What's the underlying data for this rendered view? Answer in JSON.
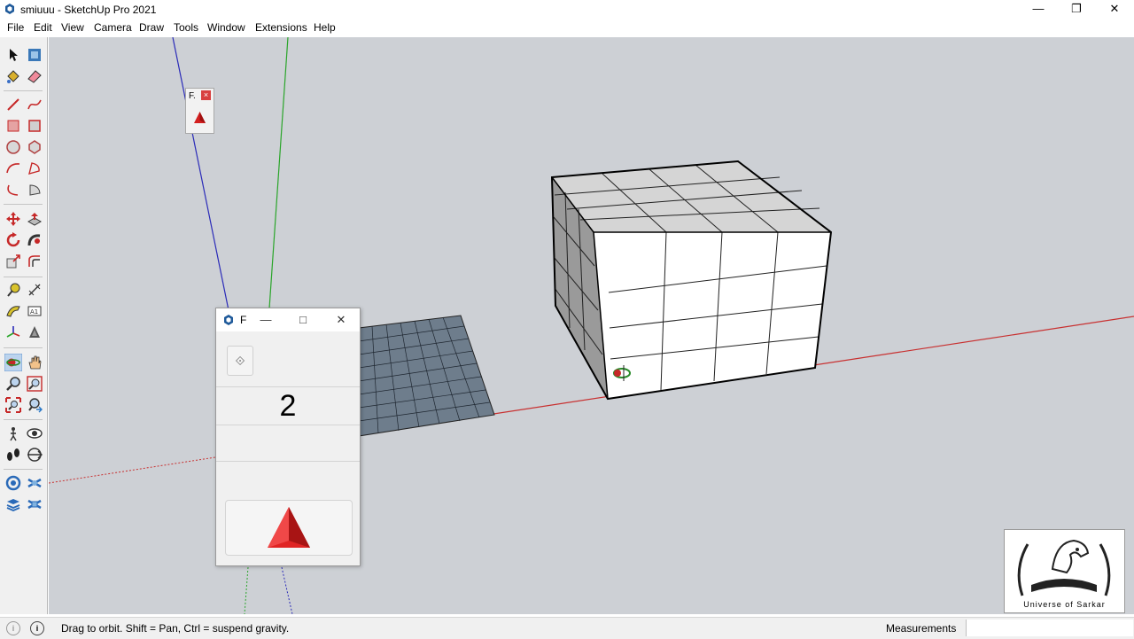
{
  "window": {
    "title": "smiuuu - SketchUp Pro 2021",
    "controls": [
      "minimize",
      "restore",
      "close"
    ]
  },
  "menu": {
    "items": [
      "File",
      "Edit",
      "View",
      "Camera",
      "Draw",
      "Tools",
      "Window",
      "Extensions",
      "Help"
    ]
  },
  "toolbar": {
    "tools": [
      "select-icon",
      "make-component-icon",
      "paint-bucket-icon",
      "eraser-icon",
      "line-icon",
      "freehand-icon",
      "rectangle-icon",
      "rotated-rectangle-icon",
      "circle-icon",
      "polygon-icon",
      "arc-icon",
      "two-point-arc-icon",
      "three-point-arc-icon",
      "pie-icon",
      "move-icon",
      "push-pull-icon",
      "rotate-icon",
      "follow-me-icon",
      "scale-icon",
      "offset-icon",
      "tape-measure-icon",
      "dimension-icon",
      "protractor-icon",
      "text-icon",
      "axes-icon",
      "3d-text-icon",
      "orbit-icon",
      "pan-icon",
      "zoom-icon",
      "zoom-window-icon",
      "zoom-extents-icon",
      "previous-view-icon",
      "position-camera-icon",
      "look-around-icon",
      "walk-icon",
      "section-plane-icon",
      "warehouse-icon",
      "extension-warehouse-icon",
      "layout-icon",
      "extension-manager-icon"
    ]
  },
  "mini_panel": {
    "title": "F.",
    "close": "×",
    "icon": "red-pyramid-icon"
  },
  "plugin_window": {
    "title": "F",
    "controls": [
      "minimize",
      "maximize",
      "close"
    ],
    "spinner_icon": "diamond-spinner-icon",
    "value": "2",
    "action_icon": "red-pyramid-icon"
  },
  "statusbar": {
    "message": "Drag to orbit. Shift = Pan, Ctrl = suspend gravity.",
    "measurements_label": "Measurements",
    "measurements_value": ""
  },
  "watermark": {
    "text": "Universe of Sarkar"
  },
  "colors": {
    "viewport_bg": "#cdd0d5",
    "red_axis": "#cc2222",
    "green_axis": "#22aa22",
    "blue_axis": "#2222bb",
    "grid_face": "#6e7d8c",
    "box_top": "#d3d3d3",
    "box_left": "#9a9a9a",
    "box_front": "#ffffff"
  }
}
